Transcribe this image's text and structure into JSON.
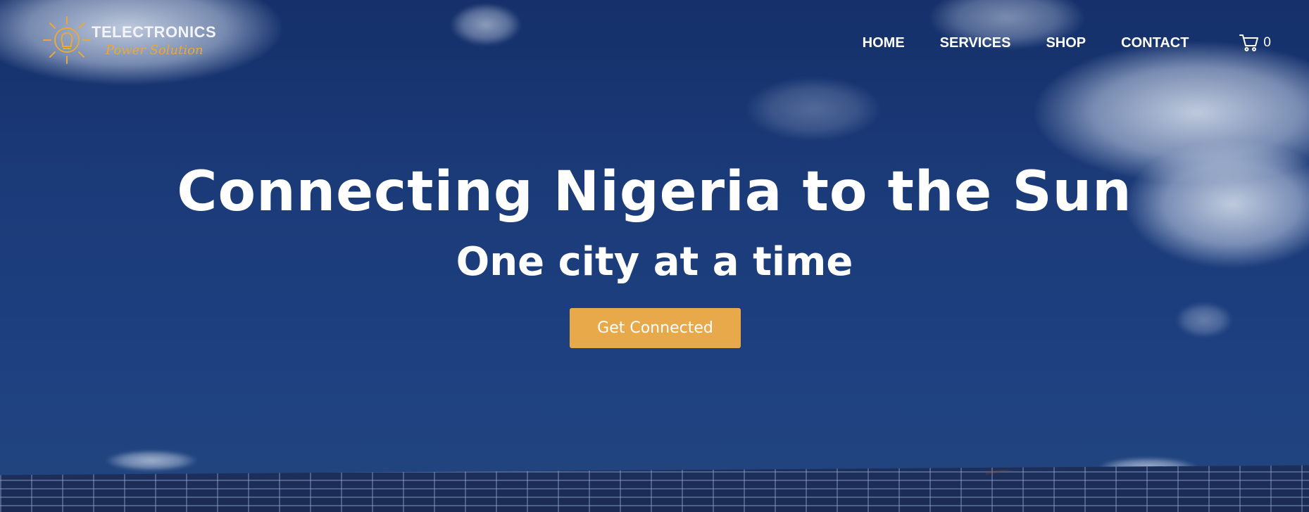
{
  "brand": {
    "name": "TELECTRONICS",
    "tagline": "Power Solution",
    "logo_icon": "lightbulb-sun-icon",
    "accent_color": "#e8a93a"
  },
  "nav": {
    "items": [
      {
        "label": "HOME"
      },
      {
        "label": "SERVICES"
      },
      {
        "label": "SHOP"
      },
      {
        "label": "CONTACT"
      }
    ],
    "cart": {
      "icon": "cart-icon",
      "count": "0"
    }
  },
  "hero": {
    "headline": "Connecting Nigeria to the Sun",
    "subheadline": "One city at a time",
    "cta_label": "Get Connected",
    "cta_color": "#e8a94a",
    "background_color": "#1b3a78"
  }
}
